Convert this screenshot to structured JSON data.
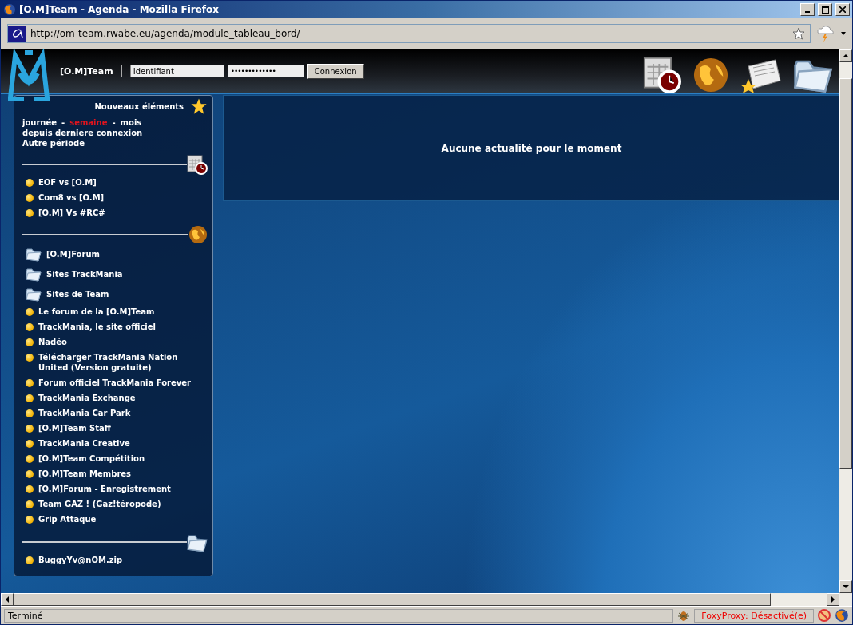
{
  "window": {
    "title": "[O.M]Team - Agenda - Mozilla Firefox"
  },
  "toolbar": {
    "url": "http://om-team.rwabe.eu/agenda/module_tableau_bord/"
  },
  "header": {
    "site_name": "[O.M]Team",
    "username": "Identifiant",
    "password": "•••••••••••••",
    "login_button": "Connexion"
  },
  "sidebar": {
    "title": "Nouveaux éléments",
    "periods": [
      {
        "label": "journée",
        "selected": false
      },
      {
        "label": "semaine",
        "selected": true
      },
      {
        "label": "mois",
        "selected": false
      }
    ],
    "period_separators": [
      "-",
      "-"
    ],
    "period_links": [
      "depuis derniere connexion",
      "Autre période"
    ],
    "sections": [
      {
        "kind": "calendar",
        "items": [
          {
            "kind": "bullet",
            "label": "EOF vs [O.M]"
          },
          {
            "kind": "bullet",
            "label": "Com8 vs [O.M]"
          },
          {
            "kind": "bullet",
            "label": "[O.M] Vs #RC#"
          }
        ]
      },
      {
        "kind": "globe",
        "items": [
          {
            "kind": "folder",
            "label": "[O.M]Forum"
          },
          {
            "kind": "folder",
            "label": "Sites TrackMania"
          },
          {
            "kind": "folder",
            "label": "Sites de Team"
          },
          {
            "kind": "bullet",
            "label": "Le forum de la [O.M]Team"
          },
          {
            "kind": "bullet",
            "label": "TrackMania, le site officiel"
          },
          {
            "kind": "bullet",
            "label": "Nadéo"
          },
          {
            "kind": "bullet",
            "label": "Télécharger TrackMania Nation United (Version gratuite)"
          },
          {
            "kind": "bullet",
            "label": "Forum officiel TrackMania Forever"
          },
          {
            "kind": "bullet",
            "label": "TrackMania Exchange"
          },
          {
            "kind": "bullet",
            "label": "TrackMania Car Park"
          },
          {
            "kind": "bullet",
            "label": "[O.M]Team Staff"
          },
          {
            "kind": "bullet",
            "label": "TrackMania Creative"
          },
          {
            "kind": "bullet",
            "label": "[O.M]Team Compétition"
          },
          {
            "kind": "bullet",
            "label": "[O.M]Team Membres"
          },
          {
            "kind": "bullet",
            "label": "[O.M]Forum - Enregistrement"
          },
          {
            "kind": "bullet",
            "label": "Team GAZ ! (Gaz!téropode)"
          },
          {
            "kind": "bullet",
            "label": "Grip Attaque"
          }
        ]
      },
      {
        "kind": "folder",
        "items": [
          {
            "kind": "bullet",
            "label": "BuggyYv@nOM.zip"
          }
        ]
      }
    ]
  },
  "main": {
    "message": "Aucune actualité pour le moment"
  },
  "status_bar": {
    "text": "Terminé",
    "proxy": "FoxyProxy: Désactivé(e)"
  }
}
